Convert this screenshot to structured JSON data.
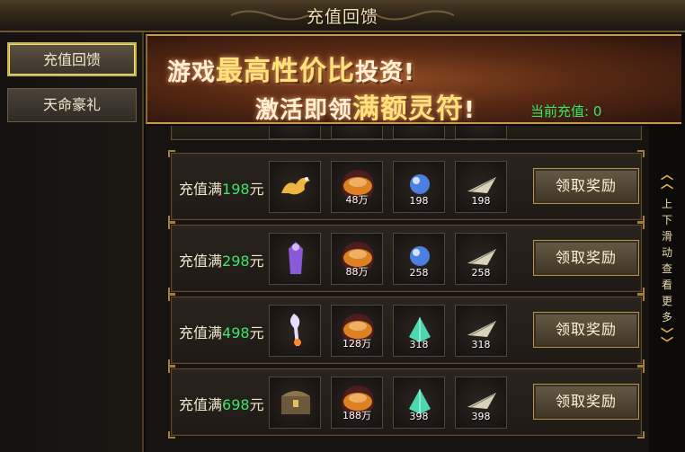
{
  "window": {
    "title": "充值回馈",
    "close_icon": "close-icon"
  },
  "sidebar": {
    "tabs": [
      {
        "label": "充值回馈",
        "active": true
      },
      {
        "label": "天命豪礼",
        "active": false
      }
    ]
  },
  "banner": {
    "line1_prefix": "游戏",
    "line1_highlight": "最高性价比",
    "line1_suffix": "投资!",
    "line2_prefix": "激活即领",
    "line2_highlight": "满额灵符",
    "line2_suffix": "!",
    "current_label": "当前充值: 0"
  },
  "rows": [
    {
      "prefix": "充值满",
      "amount": "198",
      "unit": "元",
      "items": [
        {
          "icon": "golden-dragon-icon",
          "count": ""
        },
        {
          "icon": "gold-ingot-icon",
          "count": "48万"
        },
        {
          "icon": "blue-orb-icon",
          "count": "198"
        },
        {
          "icon": "silver-feather-icon",
          "count": "198"
        }
      ],
      "button": "领取奖励"
    },
    {
      "prefix": "充值满",
      "amount": "298",
      "unit": "元",
      "items": [
        {
          "icon": "purple-armor-icon",
          "count": ""
        },
        {
          "icon": "gold-ingot-icon",
          "count": "88万"
        },
        {
          "icon": "blue-orb-icon",
          "count": "258"
        },
        {
          "icon": "silver-feather-icon",
          "count": "258"
        }
      ],
      "button": "领取奖励"
    },
    {
      "prefix": "充值满",
      "amount": "498",
      "unit": "元",
      "items": [
        {
          "icon": "flame-staff-icon",
          "count": ""
        },
        {
          "icon": "gold-ingot-icon",
          "count": "128万"
        },
        {
          "icon": "green-crystal-icon",
          "count": "318"
        },
        {
          "icon": "silver-feather-icon",
          "count": "318"
        }
      ],
      "button": "领取奖励"
    },
    {
      "prefix": "充值满",
      "amount": "698",
      "unit": "元",
      "items": [
        {
          "icon": "treasure-chest-icon",
          "count": ""
        },
        {
          "icon": "gold-ingot-icon",
          "count": "188万"
        },
        {
          "icon": "green-crystal-icon",
          "count": "398"
        },
        {
          "icon": "silver-feather-icon",
          "count": "398"
        }
      ],
      "button": "领取奖励"
    }
  ],
  "scroll_hint": {
    "text": "上下滑动查看更多",
    "icon_up": "double-chevron-up-icon",
    "icon_down": "double-chevron-down-icon"
  },
  "colors": {
    "accent_green": "#3fe46c",
    "gold": "#e0b548",
    "banner_red": "#5b2a14"
  }
}
